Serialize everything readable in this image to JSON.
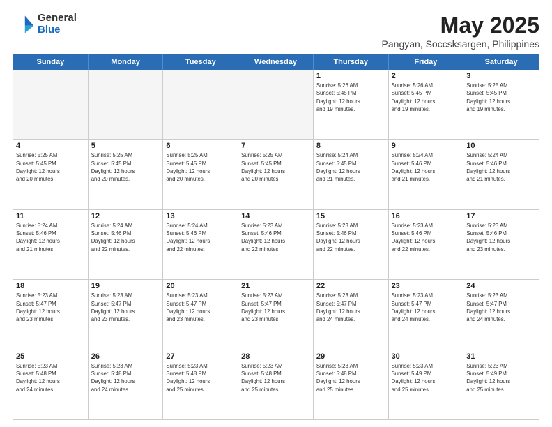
{
  "logo": {
    "general": "General",
    "blue": "Blue"
  },
  "title": "May 2025",
  "subtitle": "Pangyan, Soccsksargen, Philippines",
  "header_days": [
    "Sunday",
    "Monday",
    "Tuesday",
    "Wednesday",
    "Thursday",
    "Friday",
    "Saturday"
  ],
  "weeks": [
    [
      {
        "day": "",
        "empty": true,
        "info": ""
      },
      {
        "day": "",
        "empty": true,
        "info": ""
      },
      {
        "day": "",
        "empty": true,
        "info": ""
      },
      {
        "day": "",
        "empty": true,
        "info": ""
      },
      {
        "day": "1",
        "empty": false,
        "info": "Sunrise: 5:26 AM\nSunset: 5:45 PM\nDaylight: 12 hours\nand 19 minutes."
      },
      {
        "day": "2",
        "empty": false,
        "info": "Sunrise: 5:26 AM\nSunset: 5:45 PM\nDaylight: 12 hours\nand 19 minutes."
      },
      {
        "day": "3",
        "empty": false,
        "info": "Sunrise: 5:25 AM\nSunset: 5:45 PM\nDaylight: 12 hours\nand 19 minutes."
      }
    ],
    [
      {
        "day": "4",
        "empty": false,
        "info": "Sunrise: 5:25 AM\nSunset: 5:45 PM\nDaylight: 12 hours\nand 20 minutes."
      },
      {
        "day": "5",
        "empty": false,
        "info": "Sunrise: 5:25 AM\nSunset: 5:45 PM\nDaylight: 12 hours\nand 20 minutes."
      },
      {
        "day": "6",
        "empty": false,
        "info": "Sunrise: 5:25 AM\nSunset: 5:45 PM\nDaylight: 12 hours\nand 20 minutes."
      },
      {
        "day": "7",
        "empty": false,
        "info": "Sunrise: 5:25 AM\nSunset: 5:45 PM\nDaylight: 12 hours\nand 20 minutes."
      },
      {
        "day": "8",
        "empty": false,
        "info": "Sunrise: 5:24 AM\nSunset: 5:45 PM\nDaylight: 12 hours\nand 21 minutes."
      },
      {
        "day": "9",
        "empty": false,
        "info": "Sunrise: 5:24 AM\nSunset: 5:46 PM\nDaylight: 12 hours\nand 21 minutes."
      },
      {
        "day": "10",
        "empty": false,
        "info": "Sunrise: 5:24 AM\nSunset: 5:46 PM\nDaylight: 12 hours\nand 21 minutes."
      }
    ],
    [
      {
        "day": "11",
        "empty": false,
        "info": "Sunrise: 5:24 AM\nSunset: 5:46 PM\nDaylight: 12 hours\nand 21 minutes."
      },
      {
        "day": "12",
        "empty": false,
        "info": "Sunrise: 5:24 AM\nSunset: 5:46 PM\nDaylight: 12 hours\nand 22 minutes."
      },
      {
        "day": "13",
        "empty": false,
        "info": "Sunrise: 5:24 AM\nSunset: 5:46 PM\nDaylight: 12 hours\nand 22 minutes."
      },
      {
        "day": "14",
        "empty": false,
        "info": "Sunrise: 5:23 AM\nSunset: 5:46 PM\nDaylight: 12 hours\nand 22 minutes."
      },
      {
        "day": "15",
        "empty": false,
        "info": "Sunrise: 5:23 AM\nSunset: 5:46 PM\nDaylight: 12 hours\nand 22 minutes."
      },
      {
        "day": "16",
        "empty": false,
        "info": "Sunrise: 5:23 AM\nSunset: 5:46 PM\nDaylight: 12 hours\nand 22 minutes."
      },
      {
        "day": "17",
        "empty": false,
        "info": "Sunrise: 5:23 AM\nSunset: 5:46 PM\nDaylight: 12 hours\nand 23 minutes."
      }
    ],
    [
      {
        "day": "18",
        "empty": false,
        "info": "Sunrise: 5:23 AM\nSunset: 5:47 PM\nDaylight: 12 hours\nand 23 minutes."
      },
      {
        "day": "19",
        "empty": false,
        "info": "Sunrise: 5:23 AM\nSunset: 5:47 PM\nDaylight: 12 hours\nand 23 minutes."
      },
      {
        "day": "20",
        "empty": false,
        "info": "Sunrise: 5:23 AM\nSunset: 5:47 PM\nDaylight: 12 hours\nand 23 minutes."
      },
      {
        "day": "21",
        "empty": false,
        "info": "Sunrise: 5:23 AM\nSunset: 5:47 PM\nDaylight: 12 hours\nand 23 minutes."
      },
      {
        "day": "22",
        "empty": false,
        "info": "Sunrise: 5:23 AM\nSunset: 5:47 PM\nDaylight: 12 hours\nand 24 minutes."
      },
      {
        "day": "23",
        "empty": false,
        "info": "Sunrise: 5:23 AM\nSunset: 5:47 PM\nDaylight: 12 hours\nand 24 minutes."
      },
      {
        "day": "24",
        "empty": false,
        "info": "Sunrise: 5:23 AM\nSunset: 5:47 PM\nDaylight: 12 hours\nand 24 minutes."
      }
    ],
    [
      {
        "day": "25",
        "empty": false,
        "info": "Sunrise: 5:23 AM\nSunset: 5:48 PM\nDaylight: 12 hours\nand 24 minutes."
      },
      {
        "day": "26",
        "empty": false,
        "info": "Sunrise: 5:23 AM\nSunset: 5:48 PM\nDaylight: 12 hours\nand 24 minutes."
      },
      {
        "day": "27",
        "empty": false,
        "info": "Sunrise: 5:23 AM\nSunset: 5:48 PM\nDaylight: 12 hours\nand 25 minutes."
      },
      {
        "day": "28",
        "empty": false,
        "info": "Sunrise: 5:23 AM\nSunset: 5:48 PM\nDaylight: 12 hours\nand 25 minutes."
      },
      {
        "day": "29",
        "empty": false,
        "info": "Sunrise: 5:23 AM\nSunset: 5:48 PM\nDaylight: 12 hours\nand 25 minutes."
      },
      {
        "day": "30",
        "empty": false,
        "info": "Sunrise: 5:23 AM\nSunset: 5:49 PM\nDaylight: 12 hours\nand 25 minutes."
      },
      {
        "day": "31",
        "empty": false,
        "info": "Sunrise: 5:23 AM\nSunset: 5:49 PM\nDaylight: 12 hours\nand 25 minutes."
      }
    ]
  ]
}
